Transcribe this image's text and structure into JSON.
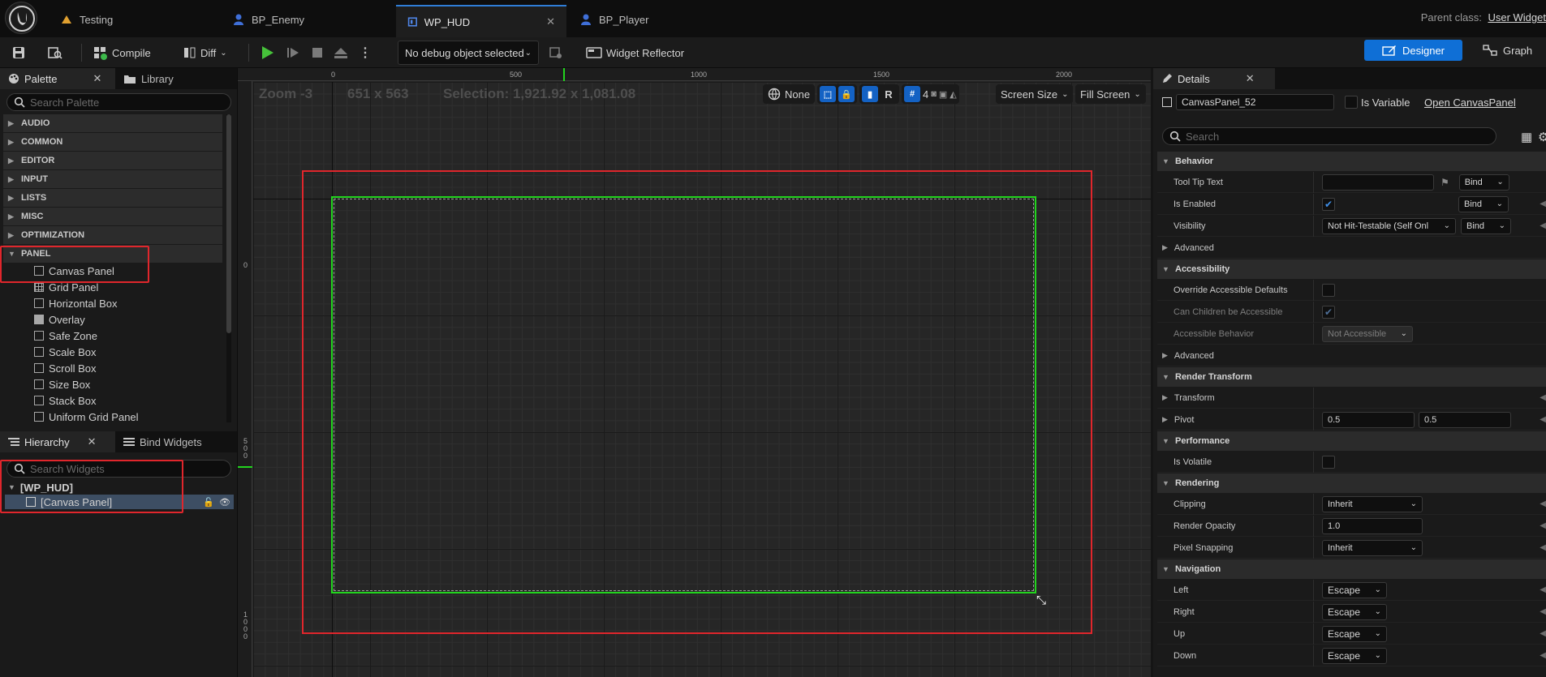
{
  "tabs": [
    {
      "label": "Testing",
      "icon": "unreal-map-icon"
    },
    {
      "label": "BP_Enemy",
      "icon": "blueprint-actor-icon"
    },
    {
      "label": "WP_HUD",
      "icon": "widget-blueprint-icon"
    },
    {
      "label": "BP_Player",
      "icon": "blueprint-actor-icon"
    }
  ],
  "parent_class": {
    "label": "Parent class:",
    "value": "User Widget"
  },
  "toolbar": {
    "compile": "Compile",
    "diff": "Diff",
    "debug_select": "No debug object selected",
    "widget_reflector": "Widget Reflector",
    "designer": "Designer",
    "graph": "Graph"
  },
  "palette": {
    "tab_palette": "Palette",
    "tab_library": "Library",
    "search_placeholder": "Search Palette",
    "categories": [
      "AUDIO",
      "COMMON",
      "EDITOR",
      "INPUT",
      "LISTS",
      "MISC",
      "OPTIMIZATION",
      "PANEL"
    ],
    "panel_items": [
      "Canvas Panel",
      "Grid Panel",
      "Horizontal Box",
      "Overlay",
      "Safe Zone",
      "Scale Box",
      "Scroll Box",
      "Size Box",
      "Stack Box",
      "Uniform Grid Panel"
    ]
  },
  "hierarchy": {
    "tab_hierarchy": "Hierarchy",
    "tab_bind": "Bind Widgets",
    "search_placeholder": "Search Widgets",
    "root": "[WP_HUD]",
    "child": "[Canvas Panel]"
  },
  "canvas": {
    "zoom": "Zoom -3",
    "size": "651 x 563",
    "selection": "Selection: 1,921.92 x 1,081.08",
    "ruler_top": [
      "0",
      "500",
      "1000",
      "1500",
      "2000"
    ],
    "ruler_left": [
      "0",
      "5\n0\n0",
      "1\n0\n0\n0"
    ],
    "none_label": "None",
    "r_label": "R",
    "grid_snap": "4",
    "screen_size": "Screen Size",
    "fill_screen": "Fill Screen"
  },
  "details": {
    "tab": "Details",
    "name": "CanvasPanel_52",
    "is_variable": "Is Variable",
    "open_link": "Open CanvasPanel",
    "search_placeholder": "Search",
    "bind": "Bind",
    "sections": {
      "behavior": "Behavior",
      "accessibility": "Accessibility",
      "render_transform": "Render Transform",
      "performance": "Performance",
      "rendering": "Rendering",
      "navigation": "Navigation"
    },
    "labels": {
      "tool_tip": "Tool Tip Text",
      "is_enabled": "Is Enabled",
      "visibility": "Visibility",
      "advanced": "Advanced",
      "override_acc": "Override Accessible Defaults",
      "can_children": "Can Children be Accessible",
      "acc_behavior": "Accessible Behavior",
      "transform": "Transform",
      "pivot": "Pivot",
      "is_volatile": "Is Volatile",
      "clipping": "Clipping",
      "render_opacity": "Render Opacity",
      "pixel_snapping": "Pixel Snapping",
      "left": "Left",
      "right": "Right",
      "up": "Up",
      "down": "Down"
    },
    "values": {
      "visibility": "Not Hit-Testable (Self Onl",
      "acc_behavior": "Not Accessible",
      "pivot_x": "0.5",
      "pivot_y": "0.5",
      "clipping": "Inherit",
      "render_opacity": "1.0",
      "pixel_snapping": "Inherit",
      "nav": "Escape"
    }
  },
  "colors": {
    "accent": "#0f6fd6",
    "highlight": "#e0262c",
    "selection": "#22d41e"
  }
}
